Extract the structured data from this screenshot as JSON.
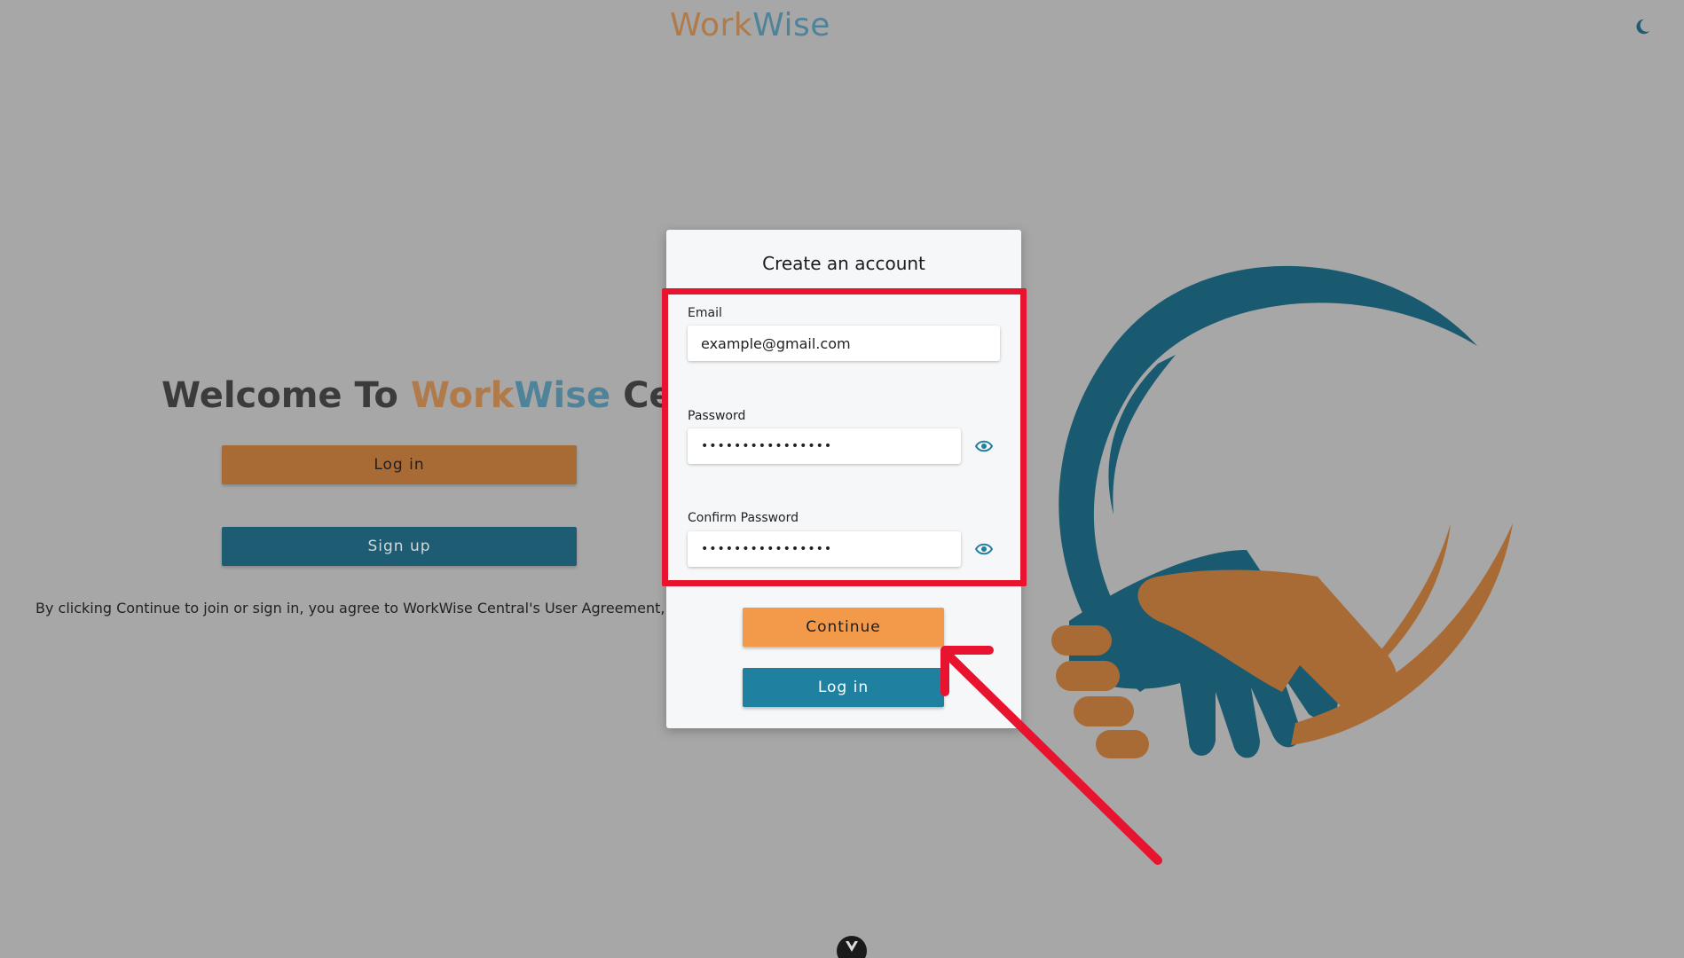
{
  "header": {
    "logo_part1": "Work",
    "logo_part2": "Wise"
  },
  "landing": {
    "welcome_prefix": "Welcome To ",
    "welcome_brand1": "Work",
    "welcome_brand2": "Wise",
    "welcome_suffix": " Centra",
    "login_label": "Log in",
    "signup_label": "Sign up",
    "terms_text": "By clicking Continue to join or sign in, you agree to WorkWise Central's User Agreement, Privacy Po"
  },
  "modal": {
    "title": "Create an account",
    "email_label": "Email",
    "email_value": "example@gmail.com",
    "password_label": "Password",
    "password_value": "••••••••••••••••",
    "confirm_label": "Confirm Password",
    "confirm_value": "••••••••••••••••",
    "continue_label": "Continue",
    "login_label": "Log in"
  },
  "icons": {
    "theme_toggle": "moon-icon",
    "show_password": "eye-icon",
    "bottom_badge": "vue-logo-icon"
  },
  "colors": {
    "background": "#a7a7a7",
    "brand_orange": "#b07a4a",
    "brand_blue": "#4f8399",
    "continue_button": "#f2994a",
    "login_button": "#20809f",
    "annotation_red": "#e8132e"
  }
}
